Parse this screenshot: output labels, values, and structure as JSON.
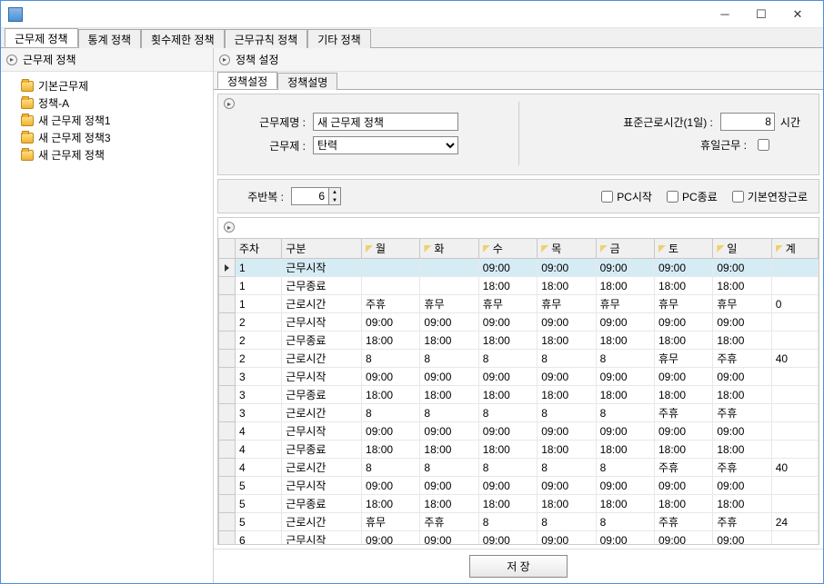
{
  "window": {
    "title": ""
  },
  "tabs": [
    "근무제 정책",
    "통계 정책",
    "횟수제한 정책",
    "근무규칙 정책",
    "기타 정책"
  ],
  "activeTab": 0,
  "sidebar": {
    "title": "근무제 정책",
    "items": [
      "기본근무제",
      "정책-A",
      "새 근무제 정책1",
      "새 근무제 정책3",
      "새 근무제 정책"
    ]
  },
  "rightHeader": "정책 설정",
  "subtabs": [
    "정책설정",
    "정책설명"
  ],
  "activeSubtab": 0,
  "form": {
    "nameLabel": "근무제명 :",
    "nameValue": "새 근무제 정책",
    "typeLabel": "근무제 :",
    "typeValue": "탄력",
    "stdLabel": "표준근로시간(1일) :",
    "stdValue": "8",
    "stdUnit": "시간",
    "holidayLabel": "휴일근무 :",
    "holidayChecked": false,
    "weekRepeatLabel": "주반복 :",
    "weekRepeatValue": "6",
    "pcStartLabel": "PC시작",
    "pcEndLabel": "PC종료",
    "baseOvertimeLabel": "기본연장근로"
  },
  "grid": {
    "columns": [
      "",
      "주차",
      "구분",
      "월",
      "화",
      "수",
      "목",
      "금",
      "토",
      "일",
      "계"
    ],
    "rows": [
      {
        "sel": true,
        "week": "1",
        "kind": "근무시작",
        "mon": "",
        "tue": "",
        "wed": "09:00",
        "thu": "09:00",
        "fri": "09:00",
        "sat": "09:00",
        "sun": "09:00",
        "tot": ""
      },
      {
        "week": "1",
        "kind": "근무종료",
        "mon": "",
        "tue": "",
        "wed": "18:00",
        "thu": "18:00",
        "fri": "18:00",
        "sat": "18:00",
        "sun": "18:00",
        "tot": ""
      },
      {
        "week": "1",
        "kind": "근로시간",
        "mon": "주휴",
        "tue": "휴무",
        "wed": "휴무",
        "thu": "휴무",
        "fri": "휴무",
        "sat": "휴무",
        "sun": "휴무",
        "tot": "0"
      },
      {
        "week": "2",
        "kind": "근무시작",
        "mon": "09:00",
        "tue": "09:00",
        "wed": "09:00",
        "thu": "09:00",
        "fri": "09:00",
        "sat": "09:00",
        "sun": "09:00",
        "tot": ""
      },
      {
        "week": "2",
        "kind": "근무종료",
        "mon": "18:00",
        "tue": "18:00",
        "wed": "18:00",
        "thu": "18:00",
        "fri": "18:00",
        "sat": "18:00",
        "sun": "18:00",
        "tot": ""
      },
      {
        "week": "2",
        "kind": "근로시간",
        "mon": "8",
        "tue": "8",
        "wed": "8",
        "thu": "8",
        "fri": "8",
        "sat": "휴무",
        "sun": "주휴",
        "tot": "40"
      },
      {
        "week": "3",
        "kind": "근무시작",
        "mon": "09:00",
        "tue": "09:00",
        "wed": "09:00",
        "thu": "09:00",
        "fri": "09:00",
        "sat": "09:00",
        "sun": "09:00",
        "tot": ""
      },
      {
        "week": "3",
        "kind": "근무종료",
        "mon": "18:00",
        "tue": "18:00",
        "wed": "18:00",
        "thu": "18:00",
        "fri": "18:00",
        "sat": "18:00",
        "sun": "18:00",
        "tot": ""
      },
      {
        "week": "3",
        "kind": "근로시간",
        "mon": "8",
        "tue": "8",
        "wed": "8",
        "thu": "8",
        "fri": "8",
        "sat": "주휴",
        "sun": "주휴",
        "tot": ""
      },
      {
        "week": "4",
        "kind": "근무시작",
        "mon": "09:00",
        "tue": "09:00",
        "wed": "09:00",
        "thu": "09:00",
        "fri": "09:00",
        "sat": "09:00",
        "sun": "09:00",
        "tot": ""
      },
      {
        "week": "4",
        "kind": "근무종료",
        "mon": "18:00",
        "tue": "18:00",
        "wed": "18:00",
        "thu": "18:00",
        "fri": "18:00",
        "sat": "18:00",
        "sun": "18:00",
        "tot": ""
      },
      {
        "week": "4",
        "kind": "근로시간",
        "mon": "8",
        "tue": "8",
        "wed": "8",
        "thu": "8",
        "fri": "8",
        "sat": "주휴",
        "sun": "주휴",
        "tot": "40"
      },
      {
        "week": "5",
        "kind": "근무시작",
        "mon": "09:00",
        "tue": "09:00",
        "wed": "09:00",
        "thu": "09:00",
        "fri": "09:00",
        "sat": "09:00",
        "sun": "09:00",
        "tot": ""
      },
      {
        "week": "5",
        "kind": "근무종료",
        "mon": "18:00",
        "tue": "18:00",
        "wed": "18:00",
        "thu": "18:00",
        "fri": "18:00",
        "sat": "18:00",
        "sun": "18:00",
        "tot": ""
      },
      {
        "week": "5",
        "kind": "근로시간",
        "mon": "휴무",
        "tue": "주휴",
        "wed": "8",
        "thu": "8",
        "fri": "8",
        "sat": "주휴",
        "sun": "주휴",
        "tot": "24"
      },
      {
        "week": "6",
        "kind": "근무시작",
        "mon": "09:00",
        "tue": "09:00",
        "wed": "09:00",
        "thu": "09:00",
        "fri": "09:00",
        "sat": "09:00",
        "sun": "09:00",
        "tot": ""
      }
    ]
  },
  "saveLabel": "저 장"
}
